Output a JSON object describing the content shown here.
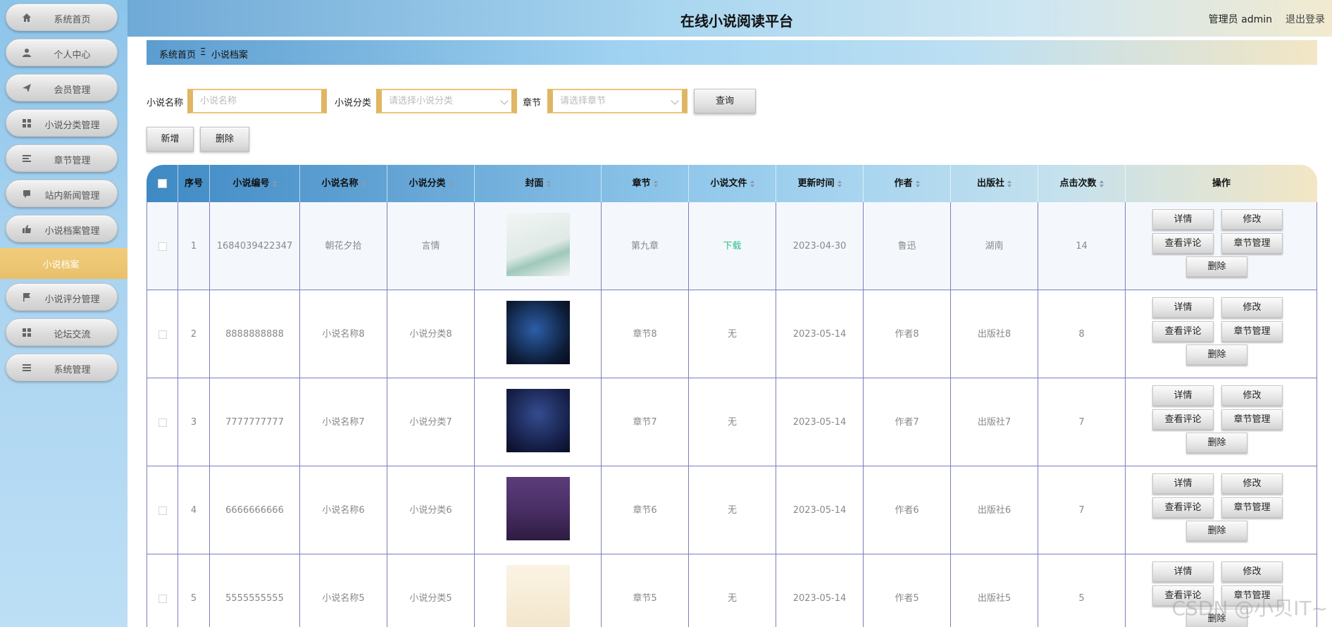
{
  "app": {
    "title": "在线小说阅读平台",
    "admin_label": "管理员 admin",
    "logout_label": "退出登录"
  },
  "sidebar": {
    "items": [
      {
        "label": "系统首页",
        "icon": "home-icon"
      },
      {
        "label": "个人中心",
        "icon": "user-icon"
      },
      {
        "label": "会员管理",
        "icon": "send-icon"
      },
      {
        "label": "小说分类管理",
        "icon": "grid-icon"
      },
      {
        "label": "章节管理",
        "icon": "list-icon"
      },
      {
        "label": "站内新闻管理",
        "icon": "chat-icon"
      },
      {
        "label": "小说档案管理",
        "icon": "thumb-icon"
      },
      {
        "label": "小说评分管理",
        "icon": "flag-icon"
      },
      {
        "label": "论坛交流",
        "icon": "grid-icon"
      },
      {
        "label": "系统管理",
        "icon": "list-icon"
      }
    ],
    "active_sub_label": "小说档案"
  },
  "breadcrumb": {
    "home": "系统首页",
    "separator": "Ξ",
    "current": "小说档案"
  },
  "search": {
    "name_label": "小说名称",
    "name_placeholder": "小说名称",
    "category_label": "小说分类",
    "category_placeholder": "请选择小说分类",
    "chapter_label": "章节",
    "chapter_placeholder": "请选择章节",
    "query_button": "查询"
  },
  "actions": {
    "add_button": "新增",
    "delete_button": "删除"
  },
  "table": {
    "headers": {
      "index": "序号",
      "code": "小说编号",
      "name": "小说名称",
      "category": "小说分类",
      "cover": "封面",
      "chapter": "章节",
      "file": "小说文件",
      "updated": "更新时间",
      "author": "作者",
      "publisher": "出版社",
      "clicks": "点击次数",
      "ops": "操作"
    },
    "rows": [
      {
        "index": "1",
        "code": "1684039422347",
        "name": "朝花夕拾",
        "category": "言情",
        "chapter": "第九章",
        "file": "下载",
        "updated": "2023-04-30",
        "author": "鲁迅",
        "publisher": "湖南",
        "clicks": "14"
      },
      {
        "index": "2",
        "code": "8888888888",
        "name": "小说名称8",
        "category": "小说分类8",
        "chapter": "章节8",
        "file": "无",
        "updated": "2023-05-14",
        "author": "作者8",
        "publisher": "出版社8",
        "clicks": "8"
      },
      {
        "index": "3",
        "code": "7777777777",
        "name": "小说名称7",
        "category": "小说分类7",
        "chapter": "章节7",
        "file": "无",
        "updated": "2023-05-14",
        "author": "作者7",
        "publisher": "出版社7",
        "clicks": "7"
      },
      {
        "index": "4",
        "code": "6666666666",
        "name": "小说名称6",
        "category": "小说分类6",
        "chapter": "章节6",
        "file": "无",
        "updated": "2023-05-14",
        "author": "作者6",
        "publisher": "出版社6",
        "clicks": "7"
      },
      {
        "index": "5",
        "code": "5555555555",
        "name": "小说名称5",
        "category": "小说分类5",
        "chapter": "章节5",
        "file": "无",
        "updated": "2023-05-14",
        "author": "作者5",
        "publisher": "出版社5",
        "clicks": "5"
      }
    ],
    "row_ops": {
      "detail": "详情",
      "edit": "修改",
      "comments": "查看评论",
      "chapters": "章节管理",
      "delete": "删除"
    }
  },
  "watermark": "CSDN @小贝IT~",
  "colors": {
    "accent_gold": "#e0b662",
    "download_green": "#2fbe87",
    "row_border": "#7a7fb8"
  }
}
